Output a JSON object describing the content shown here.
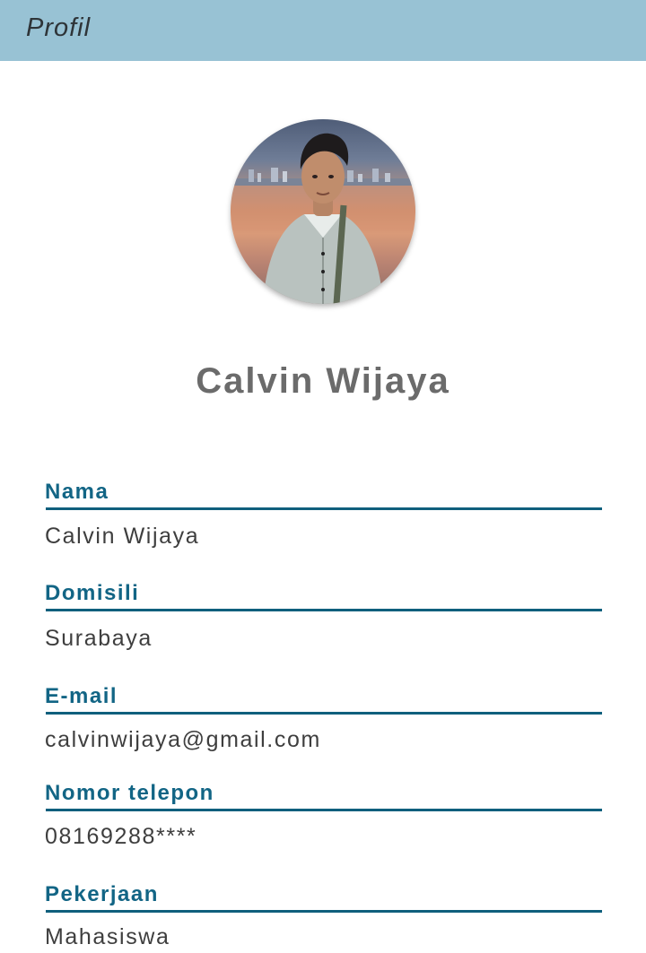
{
  "header": {
    "title": "Profil"
  },
  "profile": {
    "display_name": "Calvin Wijaya",
    "avatar_icon": "profile-photo"
  },
  "fields": [
    {
      "label": "Nama",
      "value": "Calvin Wijaya"
    },
    {
      "label": "Domisili",
      "value": "Surabaya"
    },
    {
      "label": "E-mail",
      "value": "calvinwijaya@gmail.com"
    },
    {
      "label": "Nomor telepon",
      "value": "08169288****"
    },
    {
      "label": "Pekerjaan",
      "value": "Mahasiswa"
    }
  ],
  "colors": {
    "app_bar": "#98c2d4",
    "label_accent": "#126585",
    "divider": "#0f5f7d",
    "name_text": "#6b6b6b"
  }
}
